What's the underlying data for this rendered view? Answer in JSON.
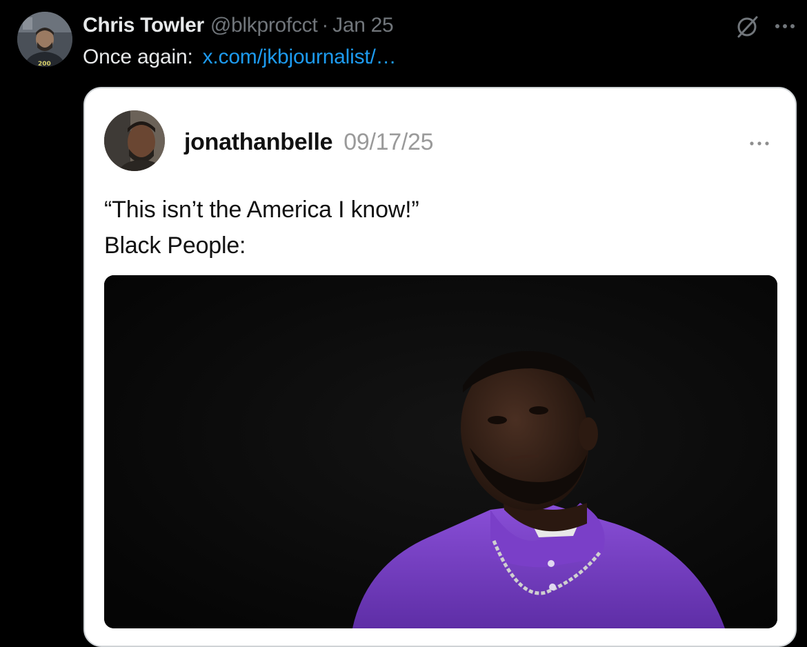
{
  "tweet": {
    "display_name": "Chris Towler",
    "handle": "@blkprofcct",
    "separator": "·",
    "date": "Jan 25",
    "text": "Once again:",
    "link": "x.com/jkbjournalist/…",
    "avatar_icon": "profile-photo",
    "grok_icon": "grok-slash-circle-icon",
    "more_icon": "more-horizontal-icon"
  },
  "quoted": {
    "username": "jonathanbelle",
    "date": "09/17/25",
    "line1": "“This isn’t the America I know!”",
    "line2": "Black People:",
    "more_icon": "more-horizontal-icon",
    "image_subject": "man-in-purple-polo-meme"
  },
  "colors": {
    "background": "#000000",
    "primary_text": "#e7e9ea",
    "secondary_text": "#71767b",
    "link": "#1d9bf0",
    "card_background": "#ffffff",
    "card_border": "#cfd3d6",
    "quoted_text": "#111111",
    "quoted_date": "#9a9a9a",
    "shirt_purple": "#7b3fc4"
  }
}
